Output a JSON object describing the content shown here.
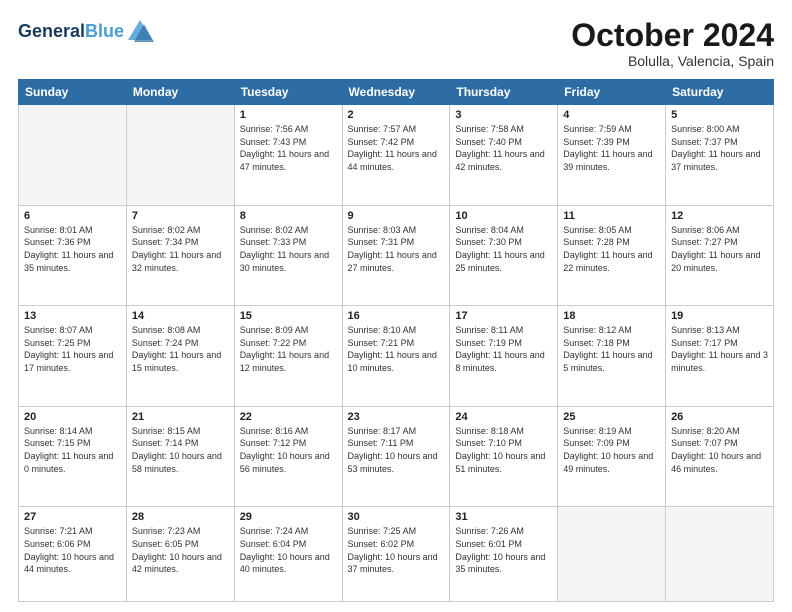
{
  "header": {
    "logo_line1": "General",
    "logo_line2": "Blue",
    "month": "October 2024",
    "location": "Bolulla, Valencia, Spain"
  },
  "weekdays": [
    "Sunday",
    "Monday",
    "Tuesday",
    "Wednesday",
    "Thursday",
    "Friday",
    "Saturday"
  ],
  "weeks": [
    [
      {
        "day": "",
        "info": ""
      },
      {
        "day": "",
        "info": ""
      },
      {
        "day": "1",
        "info": "Sunrise: 7:56 AM\nSunset: 7:43 PM\nDaylight: 11 hours and 47 minutes."
      },
      {
        "day": "2",
        "info": "Sunrise: 7:57 AM\nSunset: 7:42 PM\nDaylight: 11 hours and 44 minutes."
      },
      {
        "day": "3",
        "info": "Sunrise: 7:58 AM\nSunset: 7:40 PM\nDaylight: 11 hours and 42 minutes."
      },
      {
        "day": "4",
        "info": "Sunrise: 7:59 AM\nSunset: 7:39 PM\nDaylight: 11 hours and 39 minutes."
      },
      {
        "day": "5",
        "info": "Sunrise: 8:00 AM\nSunset: 7:37 PM\nDaylight: 11 hours and 37 minutes."
      }
    ],
    [
      {
        "day": "6",
        "info": "Sunrise: 8:01 AM\nSunset: 7:36 PM\nDaylight: 11 hours and 35 minutes."
      },
      {
        "day": "7",
        "info": "Sunrise: 8:02 AM\nSunset: 7:34 PM\nDaylight: 11 hours and 32 minutes."
      },
      {
        "day": "8",
        "info": "Sunrise: 8:02 AM\nSunset: 7:33 PM\nDaylight: 11 hours and 30 minutes."
      },
      {
        "day": "9",
        "info": "Sunrise: 8:03 AM\nSunset: 7:31 PM\nDaylight: 11 hours and 27 minutes."
      },
      {
        "day": "10",
        "info": "Sunrise: 8:04 AM\nSunset: 7:30 PM\nDaylight: 11 hours and 25 minutes."
      },
      {
        "day": "11",
        "info": "Sunrise: 8:05 AM\nSunset: 7:28 PM\nDaylight: 11 hours and 22 minutes."
      },
      {
        "day": "12",
        "info": "Sunrise: 8:06 AM\nSunset: 7:27 PM\nDaylight: 11 hours and 20 minutes."
      }
    ],
    [
      {
        "day": "13",
        "info": "Sunrise: 8:07 AM\nSunset: 7:25 PM\nDaylight: 11 hours and 17 minutes."
      },
      {
        "day": "14",
        "info": "Sunrise: 8:08 AM\nSunset: 7:24 PM\nDaylight: 11 hours and 15 minutes."
      },
      {
        "day": "15",
        "info": "Sunrise: 8:09 AM\nSunset: 7:22 PM\nDaylight: 11 hours and 12 minutes."
      },
      {
        "day": "16",
        "info": "Sunrise: 8:10 AM\nSunset: 7:21 PM\nDaylight: 11 hours and 10 minutes."
      },
      {
        "day": "17",
        "info": "Sunrise: 8:11 AM\nSunset: 7:19 PM\nDaylight: 11 hours and 8 minutes."
      },
      {
        "day": "18",
        "info": "Sunrise: 8:12 AM\nSunset: 7:18 PM\nDaylight: 11 hours and 5 minutes."
      },
      {
        "day": "19",
        "info": "Sunrise: 8:13 AM\nSunset: 7:17 PM\nDaylight: 11 hours and 3 minutes."
      }
    ],
    [
      {
        "day": "20",
        "info": "Sunrise: 8:14 AM\nSunset: 7:15 PM\nDaylight: 11 hours and 0 minutes."
      },
      {
        "day": "21",
        "info": "Sunrise: 8:15 AM\nSunset: 7:14 PM\nDaylight: 10 hours and 58 minutes."
      },
      {
        "day": "22",
        "info": "Sunrise: 8:16 AM\nSunset: 7:12 PM\nDaylight: 10 hours and 56 minutes."
      },
      {
        "day": "23",
        "info": "Sunrise: 8:17 AM\nSunset: 7:11 PM\nDaylight: 10 hours and 53 minutes."
      },
      {
        "day": "24",
        "info": "Sunrise: 8:18 AM\nSunset: 7:10 PM\nDaylight: 10 hours and 51 minutes."
      },
      {
        "day": "25",
        "info": "Sunrise: 8:19 AM\nSunset: 7:09 PM\nDaylight: 10 hours and 49 minutes."
      },
      {
        "day": "26",
        "info": "Sunrise: 8:20 AM\nSunset: 7:07 PM\nDaylight: 10 hours and 46 minutes."
      }
    ],
    [
      {
        "day": "27",
        "info": "Sunrise: 7:21 AM\nSunset: 6:06 PM\nDaylight: 10 hours and 44 minutes."
      },
      {
        "day": "28",
        "info": "Sunrise: 7:23 AM\nSunset: 6:05 PM\nDaylight: 10 hours and 42 minutes."
      },
      {
        "day": "29",
        "info": "Sunrise: 7:24 AM\nSunset: 6:04 PM\nDaylight: 10 hours and 40 minutes."
      },
      {
        "day": "30",
        "info": "Sunrise: 7:25 AM\nSunset: 6:02 PM\nDaylight: 10 hours and 37 minutes."
      },
      {
        "day": "31",
        "info": "Sunrise: 7:26 AM\nSunset: 6:01 PM\nDaylight: 10 hours and 35 minutes."
      },
      {
        "day": "",
        "info": ""
      },
      {
        "day": "",
        "info": ""
      }
    ]
  ]
}
